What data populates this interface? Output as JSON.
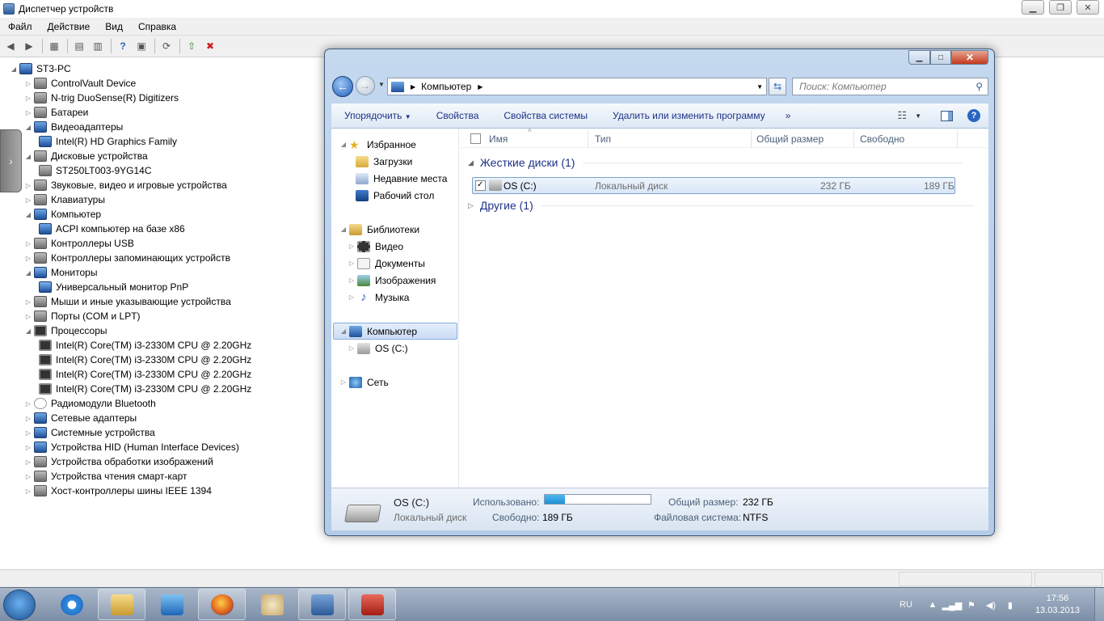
{
  "device_manager": {
    "title": "Диспетчер устройств",
    "menu": [
      "Файл",
      "Действие",
      "Вид",
      "Справка"
    ],
    "tree": [
      {
        "label": "ST3-PC",
        "level": 0,
        "expanded": true,
        "icon": "computer-icon"
      },
      {
        "label": "ControlVault Device",
        "level": 1,
        "expanded": false,
        "icon": "device-icon"
      },
      {
        "label": "N-trig DuoSense(R) Digitizers",
        "level": 1,
        "expanded": false,
        "icon": "device-icon"
      },
      {
        "label": "Батареи",
        "level": 1,
        "expanded": false,
        "icon": "battery-icon"
      },
      {
        "label": "Видеоадаптеры",
        "level": 1,
        "expanded": true,
        "icon": "display-adapter-icon"
      },
      {
        "label": "Intel(R) HD Graphics Family",
        "level": 2,
        "icon": "display-adapter-icon"
      },
      {
        "label": "Дисковые устройства",
        "level": 1,
        "expanded": true,
        "icon": "disk-drive-icon"
      },
      {
        "label": "ST250LT003-9YG14C",
        "level": 2,
        "icon": "disk-drive-icon"
      },
      {
        "label": "Звуковые, видео и игровые устройства",
        "level": 1,
        "expanded": false,
        "icon": "speaker-icon"
      },
      {
        "label": "Клавиатуры",
        "level": 1,
        "expanded": false,
        "icon": "keyboard-icon"
      },
      {
        "label": "Компьютер",
        "level": 1,
        "expanded": true,
        "icon": "computer-icon"
      },
      {
        "label": "ACPI компьютер на базе x86",
        "level": 2,
        "icon": "computer-icon"
      },
      {
        "label": "Контроллеры USB",
        "level": 1,
        "expanded": false,
        "icon": "usb-icon"
      },
      {
        "label": "Контроллеры запоминающих устройств",
        "level": 1,
        "expanded": false,
        "icon": "storage-controller-icon"
      },
      {
        "label": "Мониторы",
        "level": 1,
        "expanded": true,
        "icon": "monitor-icon"
      },
      {
        "label": "Универсальный монитор PnP",
        "level": 2,
        "icon": "monitor-icon"
      },
      {
        "label": "Мыши и иные указывающие устройства",
        "level": 1,
        "expanded": false,
        "icon": "mouse-icon"
      },
      {
        "label": "Порты (COM и LPT)",
        "level": 1,
        "expanded": false,
        "icon": "port-icon"
      },
      {
        "label": "Процессоры",
        "level": 1,
        "expanded": true,
        "icon": "cpu-icon"
      },
      {
        "label": "Intel(R) Core(TM) i3-2330M CPU @ 2.20GHz",
        "level": 2,
        "icon": "cpu-icon"
      },
      {
        "label": "Intel(R) Core(TM) i3-2330M CPU @ 2.20GHz",
        "level": 2,
        "icon": "cpu-icon"
      },
      {
        "label": "Intel(R) Core(TM) i3-2330M CPU @ 2.20GHz",
        "level": 2,
        "icon": "cpu-icon"
      },
      {
        "label": "Intel(R) Core(TM) i3-2330M CPU @ 2.20GHz",
        "level": 2,
        "icon": "cpu-icon"
      },
      {
        "label": "Радиомодули Bluetooth",
        "level": 1,
        "expanded": false,
        "icon": "bluetooth-icon"
      },
      {
        "label": "Сетевые адаптеры",
        "level": 1,
        "expanded": false,
        "icon": "network-adapter-icon"
      },
      {
        "label": "Системные устройства",
        "level": 1,
        "expanded": false,
        "icon": "system-device-icon"
      },
      {
        "label": "Устройства HID (Human Interface Devices)",
        "level": 1,
        "expanded": false,
        "icon": "hid-icon"
      },
      {
        "label": "Устройства обработки изображений",
        "level": 1,
        "expanded": false,
        "icon": "camera-icon"
      },
      {
        "label": "Устройства чтения смарт-карт",
        "level": 1,
        "expanded": false,
        "icon": "smartcard-icon"
      },
      {
        "label": "Хост-контроллеры шины IEEE 1394",
        "level": 1,
        "expanded": false,
        "icon": "firewire-icon"
      }
    ]
  },
  "explorer": {
    "address": "Компьютер",
    "search_placeholder": "Поиск: Компьютер",
    "commands": [
      "Упорядочить",
      "Свойства",
      "Свойства системы",
      "Удалить или изменить программу"
    ],
    "nav": {
      "favorites": {
        "label": "Избранное",
        "items": [
          "Загрузки",
          "Недавние места",
          "Рабочий стол"
        ]
      },
      "libraries": {
        "label": "Библиотеки",
        "items": [
          "Видео",
          "Документы",
          "Изображения",
          "Музыка"
        ]
      },
      "computer": {
        "label": "Компьютер",
        "items": [
          "OS (C:)"
        ]
      },
      "network": {
        "label": "Сеть"
      }
    },
    "columns": [
      "Имя",
      "Тип",
      "Общий размер",
      "Свободно"
    ],
    "groups": {
      "hard_disks": "Жесткие диски (1)",
      "other": "Другие (1)"
    },
    "drives": [
      {
        "name": "OS (C:)",
        "type": "Локальный диск",
        "total": "232 ГБ",
        "free": "189 ГБ"
      }
    ],
    "details": {
      "name": "OS (C:)",
      "type": "Локальный диск",
      "used_label": "Использовано:",
      "used_fraction": 0.19,
      "free_label": "Свободно:",
      "free_value": "189 ГБ",
      "total_label": "Общий размер:",
      "total_value": "232 ГБ",
      "fs_label": "Файловая система:",
      "fs_value": "NTFS"
    }
  },
  "taskbar": {
    "apps": [
      "internet-explorer-icon",
      "explorer-icon",
      "media-player-icon",
      "firefox-icon",
      "paint-icon",
      "device-manager-icon",
      "toolbox-icon"
    ],
    "lang": "RU",
    "time": "17:56",
    "date": "13.03.2013"
  }
}
